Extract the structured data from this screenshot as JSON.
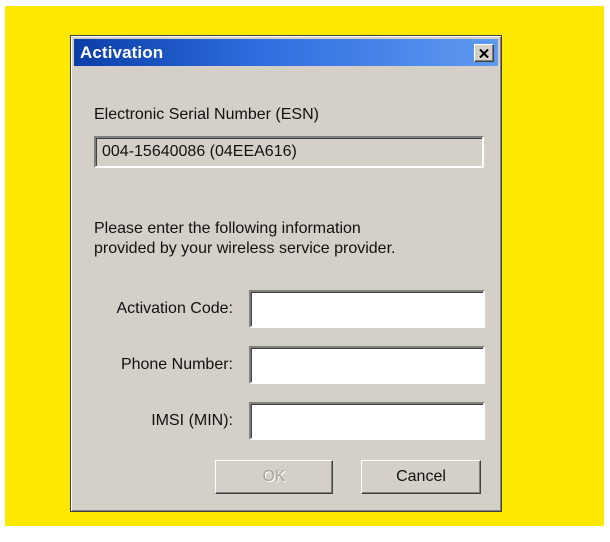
{
  "dialog": {
    "title": "Activation",
    "close_icon": "close-x-icon",
    "esn_label": "Electronic Serial Number (ESN)",
    "esn_value": "004-15640086 (04EEA616)",
    "instructions_line1": "Please enter the following information",
    "instructions_line2": "provided by your wireless service provider.",
    "fields": [
      {
        "label": "Activation Code:",
        "value": ""
      },
      {
        "label": "Phone Number:",
        "value": ""
      },
      {
        "label": "IMSI (MIN):",
        "value": ""
      }
    ],
    "ok_label": "OK",
    "cancel_label": "Cancel"
  },
  "colors": {
    "background_frame": "#ffe800",
    "titlebar": "#1a56cc",
    "dialog_face": "#d4d0c8"
  }
}
